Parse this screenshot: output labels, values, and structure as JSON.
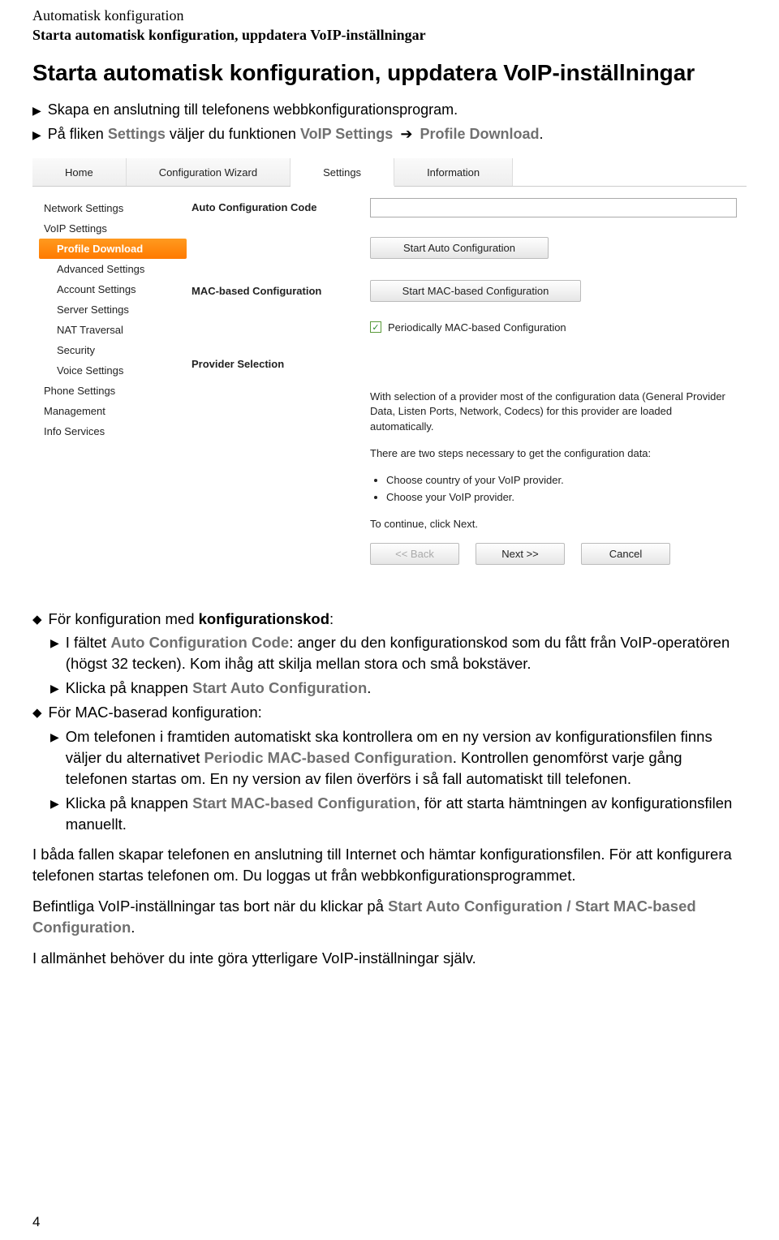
{
  "header": {
    "small": "Automatisk konfiguration",
    "bold": "Starta automatisk konfiguration, uppdatera VoIP-inställningar"
  },
  "title": "Starta automatisk konfiguration, uppdatera VoIP-inställningar",
  "intro": {
    "line1": "Skapa en anslutning till telefonens webbkonfigurationsprogram.",
    "line2_a": "På fliken ",
    "line2_b": "Settings",
    "line2_c": " väljer du funktionen ",
    "line2_d": "VoIP Settings",
    "line2_arrow": "➔",
    "line2_e": "Profile Download",
    "line2_f": "."
  },
  "ui": {
    "tabs": [
      "Home",
      "Configuration Wizard",
      "Settings",
      "Information"
    ],
    "active_tab_index": 2,
    "sidebar": {
      "items": [
        {
          "label": "Network Settings",
          "type": "top"
        },
        {
          "label": "VoIP Settings",
          "type": "top"
        },
        {
          "label": "Profile Download",
          "type": "sub",
          "active": true
        },
        {
          "label": "Advanced Settings",
          "type": "sub"
        },
        {
          "label": "Account Settings",
          "type": "sub"
        },
        {
          "label": "Server Settings",
          "type": "sub"
        },
        {
          "label": "NAT Traversal",
          "type": "sub"
        },
        {
          "label": "Security",
          "type": "sub"
        },
        {
          "label": "Voice Settings",
          "type": "sub"
        },
        {
          "label": "Phone Settings",
          "type": "top"
        },
        {
          "label": "Management",
          "type": "top"
        },
        {
          "label": "Info Services",
          "type": "top"
        }
      ]
    },
    "form": {
      "auto_conf_label": "Auto Configuration Code",
      "start_auto_btn": "Start Auto Configuration",
      "mac_conf_label": "MAC-based Configuration",
      "start_mac_btn": "Start MAC-based Configuration",
      "periodic_check_label": "Periodically MAC-based Configuration",
      "provider_label": "Provider Selection",
      "provider_p1": "With selection of a provider most of the configuration data (General Provider Data, Listen Ports, Network, Codecs) for this provider are loaded automatically.",
      "provider_p2": "There are two steps necessary to get the configuration data:",
      "provider_li1": "Choose country of your VoIP provider.",
      "provider_li2": "Choose your VoIP provider.",
      "provider_p3": "To continue, click Next.",
      "back_btn": "<< Back",
      "next_btn": "Next >>",
      "cancel_btn": "Cancel"
    }
  },
  "body": {
    "d1": "För konfiguration med ",
    "d1b": "konfigurationskod",
    "d1c": ":",
    "d1_s1a": "I fältet ",
    "d1_s1b": "Auto Configuration Code",
    "d1_s1c": ": anger du den konfigurationskod som du fått från VoIP-operatören (högst 32 tecken). Kom ihåg att skilja mellan stora och små bokstäver.",
    "d1_s2a": "Klicka på knappen ",
    "d1_s2b": "Start Auto Configuration",
    "d1_s2c": ".",
    "d2": "För MAC-baserad konfiguration:",
    "d2_s1a": "Om telefonen i framtiden automatiskt ska kontrollera om en ny version av konfigurationsfilen finns väljer du alternativet ",
    "d2_s1b": "Periodic MAC-based Configuration",
    "d2_s1c": ". Kontrollen genomförst varje gång telefonen startas om. En ny version av filen överförs i så fall automatiskt till telefonen.",
    "d2_s2a": "Klicka på knappen ",
    "d2_s2b": "Start MAC-based Configuration",
    "d2_s2c": ", för att starta hämtningen av konfigurationsfilen manuellt.",
    "p1": "I båda fallen skapar telefonen en anslutning till Internet och hämtar konfigurationsfilen. För att konfigurera telefonen startas telefonen om. Du loggas ut från webbkonfigurationsprogrammet.",
    "p2a": "Befintliga VoIP-inställningar tas bort när du klickar på ",
    "p2b": "Start Auto Configuration / Start MAC-based Configuration",
    "p2c": ".",
    "p3": "I allmänhet behöver du inte göra ytterligare VoIP-inställningar själv."
  },
  "page_number": "4"
}
